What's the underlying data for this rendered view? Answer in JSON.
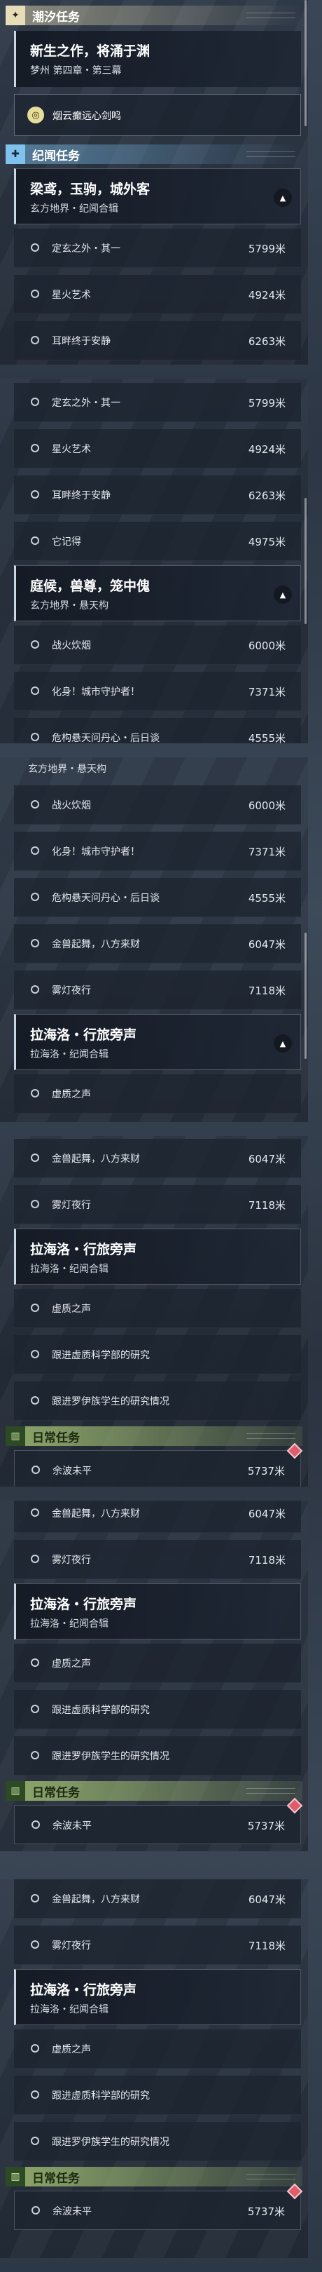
{
  "sections": {
    "chaoxi": "潮汐任务",
    "jiwen": "纪闻任务",
    "daily": "日常任务"
  },
  "icons": {
    "chaoxi": "star-icon",
    "jiwen": "plus-icon",
    "daily": "book-icon"
  },
  "colors": {
    "blue_section": "#7fc3ec",
    "beige_section": "#e6dcb8",
    "green_section": "#aac878",
    "alert": "#e05c6a"
  },
  "quests": {
    "xinsheng": {
      "title": "新生之作，将涌于渊",
      "sub": "梦州 第四章・第三幕"
    },
    "special": {
      "label": "烟云癫远心剑鸣"
    },
    "liangniao": {
      "title": "梁鸢，玉驹，城外客",
      "sub": "玄方地界・纪闻合辑"
    },
    "tinghou": {
      "title": "庭候，兽尊，笼中傀",
      "sub": "玄方地界・悬天构"
    },
    "lahailuo": {
      "title": "拉海洛・行旅旁声",
      "sub": "拉海洛・纪闻合辑"
    }
  },
  "items": {
    "dingxuan": "定玄之外・其一",
    "xinghuo": "星火艺术",
    "ermei": "耳畔终于安静",
    "tajide": "它记得",
    "zhanhuo": "战火炊烟",
    "huashen": "化身！城市守护者！",
    "weigou": "危构悬天问丹心・后日谈",
    "jinshou": "金兽起舞，八方来财",
    "wudeng": "雾灯夜行",
    "xuzhi": "虚质之声",
    "genjin1": "跟进虚质科学部的研究",
    "genjin2": "跟进罗伊族学生的研究情况",
    "yubo": "余波未平"
  },
  "dist": {
    "dingxuan": "5799米",
    "xinghuo": "4924米",
    "ermei": "6263米",
    "tajide": "4975米",
    "zhanhuo": "6000米",
    "huashen": "7371米",
    "weigou": "4555米",
    "jinshou": "6047米",
    "wudeng": "7118米",
    "yubo": "5737米"
  }
}
